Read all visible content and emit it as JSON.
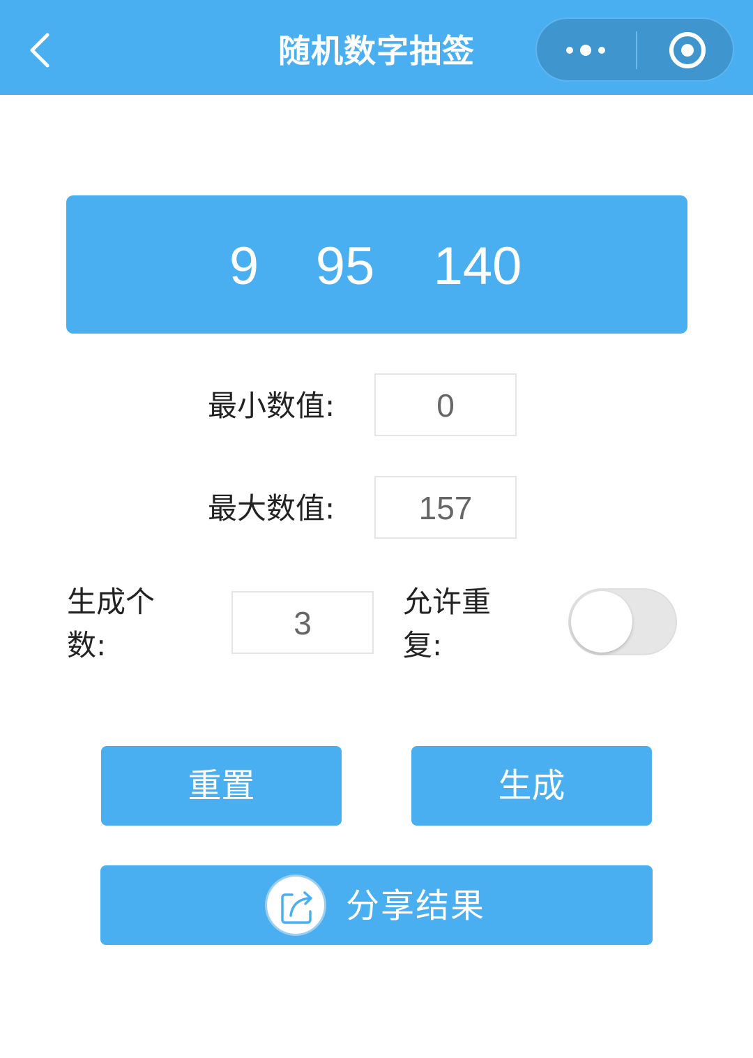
{
  "nav": {
    "title": "随机数字抽签",
    "back_icon": "chevron-left-icon",
    "more_icon": "more-dots-icon",
    "close_icon": "target-circle-icon"
  },
  "result": {
    "numbers": [
      "9",
      "95",
      "140"
    ]
  },
  "form": {
    "min_label": "最小数值:",
    "min_value": "0",
    "max_label": "最大数值:",
    "max_value": "157",
    "count_label": "生成个数:",
    "count_value": "3",
    "repeat_label": "允许重复:",
    "repeat_enabled": false
  },
  "buttons": {
    "reset_label": "重置",
    "generate_label": "生成",
    "share_label": "分享结果",
    "share_icon": "share-icon"
  },
  "colors": {
    "primary": "#4aaff1",
    "capsule": "#3f95cd",
    "toggle_off": "#e6e6e6"
  }
}
